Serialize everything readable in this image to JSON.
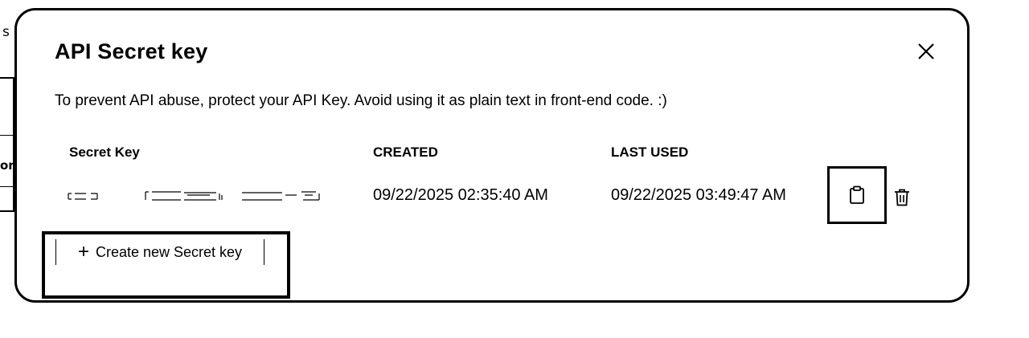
{
  "background": {
    "fragment_top": "s",
    "fragment_mid": "on:"
  },
  "modal": {
    "title": "API Secret key",
    "description": "To prevent API abuse, protect your API Key. Avoid using it as plain text in front-end code. :)",
    "close_icon": "close-icon"
  },
  "table": {
    "headers": {
      "secret_key": "Secret Key",
      "created": "CREATED",
      "last_used": "LAST USED"
    },
    "rows": [
      {
        "created": "09/22/2025 02:35:40 AM",
        "last_used": "09/22/2025 03:49:47 AM",
        "actions": [
          "clipboard-icon",
          "trash-icon"
        ]
      }
    ]
  },
  "create_button": {
    "plus": "+",
    "label": "Create new Secret key"
  }
}
